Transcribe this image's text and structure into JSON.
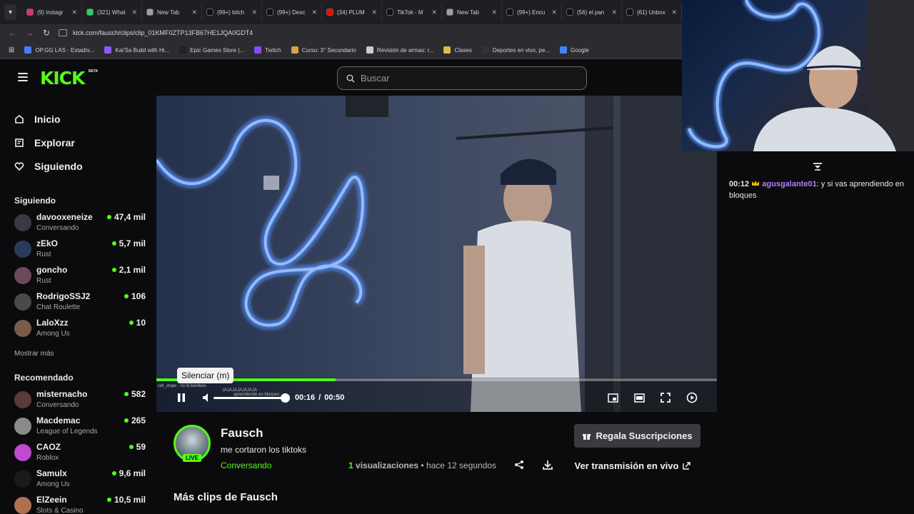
{
  "browser": {
    "tabs": [
      {
        "label": "(9) Instagr",
        "color": "#e1306c"
      },
      {
        "label": "(321) What",
        "color": "#25d366"
      },
      {
        "label": "New Tab",
        "color": "#9aa0a6"
      },
      {
        "label": "(99+) bitch",
        "color": "#111111"
      },
      {
        "label": "(99+) Desc",
        "color": "#111111"
      },
      {
        "label": "(34) PLUM",
        "color": "#ff0000"
      },
      {
        "label": "TikTok - M",
        "color": "#111111"
      },
      {
        "label": "New Tab",
        "color": "#9aa0a6"
      },
      {
        "label": "(99+) Encu",
        "color": "#111111"
      },
      {
        "label": "(56) el pan",
        "color": "#111111"
      },
      {
        "label": "(61) Unbox",
        "color": "#111111"
      }
    ],
    "url": "kick.com/fausch/clips/clip_01KMF0ZTP13FB67HE1JQA0GDT4",
    "bookmarks": [
      {
        "label": "OP.GG LAS - Estadís...",
        "color": "#4a7cff"
      },
      {
        "label": "Kai'Sa Build with Hi...",
        "color": "#8a5cff"
      },
      {
        "label": "Epic Games Store |...",
        "color": "#222222"
      },
      {
        "label": "Twitch",
        "color": "#9146ff"
      },
      {
        "label": "Curso: 3° Secundario",
        "color": "#d9a24a"
      },
      {
        "label": "Revisión de armas: r...",
        "color": "#cccccc"
      },
      {
        "label": "Clases",
        "color": "#d9c04a"
      },
      {
        "label": "Deportes en vivo, pe...",
        "color": "#333333"
      },
      {
        "label": "Google",
        "color": "#4285f4"
      }
    ]
  },
  "header": {
    "logo": "KICK",
    "logo_badge": "BETA",
    "search_placeholder": "Buscar"
  },
  "sidebar": {
    "nav": [
      {
        "label": "Inicio",
        "icon": "home-icon"
      },
      {
        "label": "Explorar",
        "icon": "compass-icon"
      },
      {
        "label": "Siguiendo",
        "icon": "heart-icon"
      }
    ],
    "following_title": "Siguiendo",
    "following": [
      {
        "name": "davooxeneize",
        "category": "Conversando",
        "viewers": "47,4 mil",
        "color": "#3a3a44"
      },
      {
        "name": "zEkO",
        "category": "Rust",
        "viewers": "5,7 mil",
        "color": "#2a3a5a"
      },
      {
        "name": "goncho",
        "category": "Rust",
        "viewers": "2,1 mil",
        "color": "#6a4a5a"
      },
      {
        "name": "RodrigoSSJ2",
        "category": "Chat Roulette",
        "viewers": "106",
        "color": "#4a4a4a"
      },
      {
        "name": "LaloXzz",
        "category": "Among Us",
        "viewers": "10",
        "color": "#7a5a4a"
      }
    ],
    "show_more": "Mostrar más",
    "recommended_title": "Recomendado",
    "recommended": [
      {
        "name": "misternacho",
        "category": "Conversando",
        "viewers": "582",
        "color": "#5a3a3a"
      },
      {
        "name": "Macdemac",
        "category": "League of Legends",
        "viewers": "265",
        "color": "#8a8a8a"
      },
      {
        "name": "CAOZ",
        "category": "Roblox",
        "viewers": "59",
        "color": "#c04ad0"
      },
      {
        "name": "Samulx",
        "category": "Among Us",
        "viewers": "9,6 mil",
        "color": "#1a1a1a"
      },
      {
        "name": "ElZeein",
        "category": "Slots & Casino",
        "viewers": "10,5 mil",
        "color": "#b07050"
      }
    ]
  },
  "player": {
    "tooltip": "Silenciar (m)",
    "current_time": "00:16",
    "separator": "/",
    "duration": "00:50",
    "progress_fraction": 0.32,
    "overlay_chat": [
      "rafi_stupe : no lo bardees",
      "JAJAJAJAJAJAJA",
      "aprendiendo en bloques"
    ]
  },
  "clip": {
    "channel": "Fausch",
    "live_badge": "LIVE",
    "title": "me cortaron los tiktoks",
    "category": "Conversando",
    "gift_label": "Regala Suscripciones",
    "views_count": "1",
    "views_label": "visualizaciones",
    "time_ago": "• hace 12 segundos",
    "watch_live": "Ver transmisión en vivo",
    "more_clips": "Más clips de Fausch"
  },
  "chat": {
    "messages": [
      {
        "time": "00:12",
        "user": "agusgalante01",
        "text": ": y si vas aprendiendo en bloques"
      }
    ]
  },
  "colors": {
    "brand": "#53fc18",
    "background": "#0b0b0d"
  }
}
